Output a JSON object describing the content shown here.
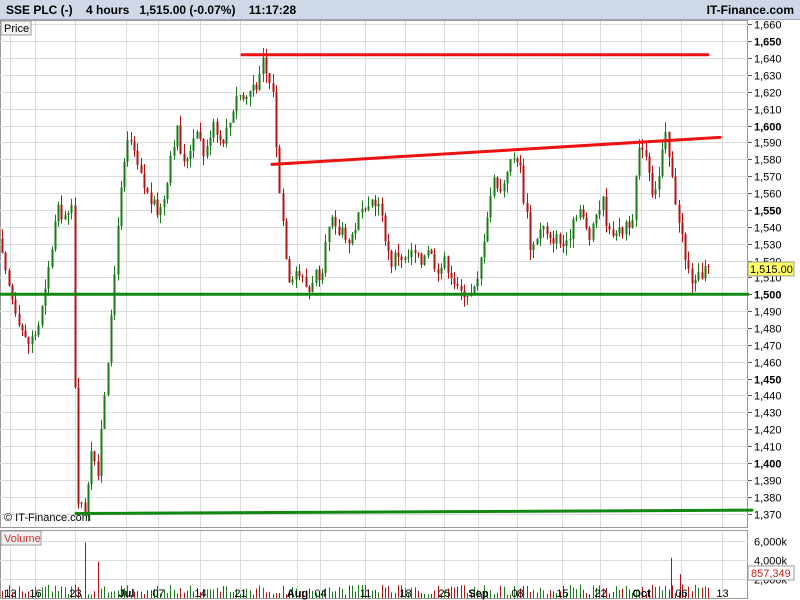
{
  "header": {
    "symbol": "SSE PLC (-)",
    "interval": "4 hours",
    "price": "1,515.00 (-0.07%)",
    "time": "11:17:28",
    "brand": "IT-Finance.com"
  },
  "chart_data": {
    "type": "candlestick",
    "price_label": "Price",
    "volume_label": "Volume",
    "watermark": "© IT-Finance.com",
    "last_price_tag": "1,515.00",
    "volume_last_tag": "857,349",
    "ylim": [
      1362,
      1662
    ],
    "y_ticks": [
      {
        "value": 1370,
        "label": "1,370",
        "bold": false
      },
      {
        "value": 1380,
        "label": "1,380",
        "bold": false
      },
      {
        "value": 1390,
        "label": "1,390",
        "bold": false
      },
      {
        "value": 1400,
        "label": "1,400",
        "bold": true
      },
      {
        "value": 1410,
        "label": "1,410",
        "bold": false
      },
      {
        "value": 1420,
        "label": "1,420",
        "bold": false
      },
      {
        "value": 1430,
        "label": "1,430",
        "bold": false
      },
      {
        "value": 1440,
        "label": "1,440",
        "bold": false
      },
      {
        "value": 1450,
        "label": "1,450",
        "bold": true
      },
      {
        "value": 1460,
        "label": "1,460",
        "bold": false
      },
      {
        "value": 1470,
        "label": "1,470",
        "bold": false
      },
      {
        "value": 1480,
        "label": "1,480",
        "bold": false
      },
      {
        "value": 1490,
        "label": "1,490",
        "bold": false
      },
      {
        "value": 1500,
        "label": "1,500",
        "bold": true
      },
      {
        "value": 1510,
        "label": "1,510",
        "bold": false
      },
      {
        "value": 1520,
        "label": "1,520",
        "bold": false
      },
      {
        "value": 1530,
        "label": "1,530",
        "bold": false
      },
      {
        "value": 1540,
        "label": "1,540",
        "bold": false
      },
      {
        "value": 1550,
        "label": "1,550",
        "bold": true
      },
      {
        "value": 1560,
        "label": "1,560",
        "bold": false
      },
      {
        "value": 1570,
        "label": "1,570",
        "bold": false
      },
      {
        "value": 1580,
        "label": "1,580",
        "bold": false
      },
      {
        "value": 1590,
        "label": "1,590",
        "bold": false
      },
      {
        "value": 1600,
        "label": "1,600",
        "bold": true
      },
      {
        "value": 1610,
        "label": "1,610",
        "bold": false
      },
      {
        "value": 1620,
        "label": "1,620",
        "bold": false
      },
      {
        "value": 1630,
        "label": "1,630",
        "bold": false
      },
      {
        "value": 1640,
        "label": "1,640",
        "bold": false
      },
      {
        "value": 1650,
        "label": "1,650",
        "bold": true
      },
      {
        "value": 1660,
        "label": "1,660",
        "bold": false
      }
    ],
    "volume_ticks": [
      {
        "value": 6000000,
        "label": "6,000k"
      },
      {
        "value": 4000000,
        "label": "4,000k"
      },
      {
        "value": 2000000,
        "label": "2,000k"
      }
    ],
    "volume_ylim": [
      0,
      7000000
    ],
    "x_ticks": [
      {
        "label": "13",
        "bold": false
      },
      {
        "label": "16",
        "bold": false
      },
      {
        "label": "23",
        "bold": false
      },
      {
        "label": "Jul",
        "bold": true
      },
      {
        "label": "07",
        "bold": false
      },
      {
        "label": "14",
        "bold": false
      },
      {
        "label": "21",
        "bold": false
      },
      {
        "label": "Aug",
        "bold": true
      },
      {
        "label": "04",
        "bold": false
      },
      {
        "label": "11",
        "bold": false
      },
      {
        "label": "18",
        "bold": false
      },
      {
        "label": "25",
        "bold": false
      },
      {
        "label": "Sep",
        "bold": true
      },
      {
        "label": "08",
        "bold": false
      },
      {
        "label": "15",
        "bold": false
      },
      {
        "label": "22",
        "bold": false
      },
      {
        "label": "Oct",
        "bold": true
      },
      {
        "label": "06",
        "bold": false
      },
      {
        "label": "13",
        "bold": false
      }
    ],
    "anchors": [
      [
        0,
        1540
      ],
      [
        8,
        1512
      ],
      [
        14,
        1500
      ],
      [
        22,
        1485
      ],
      [
        30,
        1470
      ],
      [
        40,
        1478
      ],
      [
        48,
        1500
      ],
      [
        60,
        1550
      ],
      [
        72,
        1545
      ],
      [
        76,
        1555
      ],
      [
        79,
        1385
      ],
      [
        83,
        1375
      ],
      [
        88,
        1372
      ],
      [
        92,
        1395
      ],
      [
        96,
        1420
      ],
      [
        100,
        1378
      ],
      [
        104,
        1420
      ],
      [
        108,
        1445
      ],
      [
        112,
        1470
      ],
      [
        116,
        1495
      ],
      [
        120,
        1540
      ],
      [
        126,
        1570
      ],
      [
        132,
        1595
      ],
      [
        138,
        1580
      ],
      [
        146,
        1565
      ],
      [
        154,
        1555
      ],
      [
        162,
        1548
      ],
      [
        168,
        1560
      ],
      [
        174,
        1585
      ],
      [
        180,
        1598
      ],
      [
        186,
        1575
      ],
      [
        192,
        1585
      ],
      [
        200,
        1600
      ],
      [
        208,
        1580
      ],
      [
        216,
        1605
      ],
      [
        224,
        1590
      ],
      [
        232,
        1600
      ],
      [
        240,
        1620
      ],
      [
        248,
        1615
      ],
      [
        256,
        1625
      ],
      [
        262,
        1625
      ],
      [
        266,
        1638
      ],
      [
        272,
        1625
      ],
      [
        276,
        1622
      ],
      [
        280,
        1577
      ],
      [
        284,
        1555
      ],
      [
        288,
        1530
      ],
      [
        292,
        1510
      ],
      [
        300,
        1515
      ],
      [
        306,
        1508
      ],
      [
        312,
        1502
      ],
      [
        318,
        1515
      ],
      [
        324,
        1500
      ],
      [
        328,
        1525
      ],
      [
        334,
        1545
      ],
      [
        340,
        1535
      ],
      [
        346,
        1540
      ],
      [
        352,
        1530
      ],
      [
        358,
        1540
      ],
      [
        364,
        1550
      ],
      [
        370,
        1545
      ],
      [
        376,
        1558
      ],
      [
        382,
        1552
      ],
      [
        388,
        1535
      ],
      [
        394,
        1518
      ],
      [
        400,
        1525
      ],
      [
        408,
        1520
      ],
      [
        416,
        1525
      ],
      [
        424,
        1518
      ],
      [
        430,
        1530
      ],
      [
        436,
        1520
      ],
      [
        442,
        1515
      ],
      [
        448,
        1520
      ],
      [
        456,
        1510
      ],
      [
        462,
        1500
      ],
      [
        468,
        1502
      ],
      [
        474,
        1500
      ],
      [
        480,
        1505
      ],
      [
        486,
        1530
      ],
      [
        492,
        1555
      ],
      [
        498,
        1570
      ],
      [
        504,
        1560
      ],
      [
        510,
        1575
      ],
      [
        516,
        1580
      ],
      [
        522,
        1582
      ],
      [
        526,
        1560
      ],
      [
        530,
        1548
      ],
      [
        534,
        1525
      ],
      [
        540,
        1535
      ],
      [
        546,
        1540
      ],
      [
        552,
        1530
      ],
      [
        558,
        1535
      ],
      [
        564,
        1530
      ],
      [
        570,
        1528
      ],
      [
        576,
        1545
      ],
      [
        582,
        1552
      ],
      [
        588,
        1540
      ],
      [
        594,
        1532
      ],
      [
        600,
        1550
      ],
      [
        606,
        1555
      ],
      [
        612,
        1535
      ],
      [
        618,
        1540
      ],
      [
        624,
        1535
      ],
      [
        630,
        1545
      ],
      [
        636,
        1540
      ],
      [
        640,
        1580
      ],
      [
        646,
        1590
      ],
      [
        652,
        1575
      ],
      [
        656,
        1560
      ],
      [
        662,
        1570
      ],
      [
        668,
        1595
      ],
      [
        672,
        1580
      ],
      [
        676,
        1565
      ],
      [
        680,
        1550
      ],
      [
        684,
        1540
      ],
      [
        688,
        1520
      ],
      [
        694,
        1510
      ],
      [
        698,
        1505
      ],
      [
        704,
        1512
      ],
      [
        707,
        1515
      ]
    ],
    "volume_spikes": [
      {
        "x": 85,
        "value": 5800000
      },
      {
        "x": 98,
        "value": 3800000
      },
      {
        "x": 671,
        "value": 4200000
      },
      {
        "x": 680,
        "value": 2500000
      }
    ],
    "trendlines": [
      {
        "id": "resistance-top",
        "color": "#ee1111",
        "p1": [
          242,
          1642
        ],
        "p2": [
          708,
          1642
        ]
      },
      {
        "id": "resistance-rising",
        "color": "#ee1111",
        "p1": [
          272,
          1577
        ],
        "p2": [
          720,
          1593
        ]
      },
      {
        "id": "support-mid",
        "color": "#118811",
        "p1": [
          0,
          1500
        ],
        "p2": [
          748,
          1500
        ]
      },
      {
        "id": "support-low",
        "color": "#118811",
        "p1": [
          76,
          1370
        ],
        "p2": [
          752,
          1372
        ]
      }
    ],
    "colors": {
      "up": "#1a7a1a",
      "down": "#b01515",
      "grid": "#dcdcdc",
      "tag_bg": "#ffff66",
      "volume_tag_bg": "#ffffff",
      "volume_tag_text": "#cc2222"
    }
  }
}
